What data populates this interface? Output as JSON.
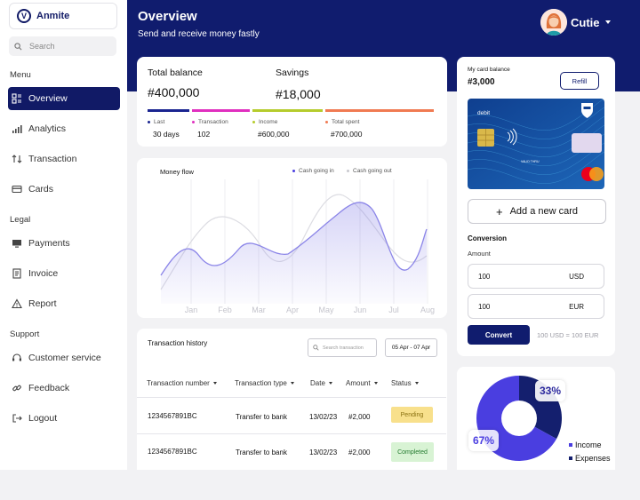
{
  "app": {
    "name": "Anmite",
    "logo_letter": "V"
  },
  "search": {
    "placeholder": "Search"
  },
  "sidebar": {
    "sections": {
      "menu": "Menu",
      "legal": "Legal",
      "support": "Support"
    },
    "items": [
      {
        "label": "Overview",
        "icon": "grid-icon",
        "active": true
      },
      {
        "label": "Analytics",
        "icon": "bar-chart-icon"
      },
      {
        "label": "Transaction",
        "icon": "swap-arrows-icon"
      },
      {
        "label": "Cards",
        "icon": "credit-card-icon"
      },
      {
        "label": "Payments",
        "icon": "monitor-icon"
      },
      {
        "label": "Invoice",
        "icon": "invoice-icon"
      },
      {
        "label": "Report",
        "icon": "warning-triangle-icon"
      },
      {
        "label": "Customer service",
        "icon": "headset-icon"
      },
      {
        "label": "Feedback",
        "icon": "link-icon"
      },
      {
        "label": "Logout",
        "icon": "logout-icon"
      }
    ]
  },
  "header": {
    "title": "Overview",
    "subtitle": "Send and receive money fastly",
    "user": "Cutie"
  },
  "balance": {
    "total_label": "Total balance",
    "total_value": "#400,000",
    "savings_label": "Savings",
    "savings_value": "#18,000",
    "stats": [
      {
        "label": "Last",
        "value": "30 days",
        "color": "#1a2490"
      },
      {
        "label": "Transaction",
        "value": "102",
        "color": "#e02fbf"
      },
      {
        "label": "Income",
        "value": "#600,000",
        "color": "#b5cc2c"
      },
      {
        "label": "Total spent",
        "value": "#700,000",
        "color": "#f07a52"
      }
    ]
  },
  "money_flow": {
    "title": "Money flow",
    "legend_in": "Cash going in",
    "legend_out": "Cash going out",
    "months": [
      "Jan",
      "Feb",
      "Mar",
      "Apr",
      "May",
      "Jun",
      "Jul",
      "Aug"
    ]
  },
  "transactions": {
    "title": "Transaction history",
    "search_placeholder": "Search transaction",
    "date_range": "05 Apr - 07 Apr",
    "columns": [
      "Transaction number",
      "Transaction type",
      "Date",
      "Amount",
      "Status"
    ],
    "rows": [
      {
        "number": "1234567891BC",
        "type": "Transfer to bank",
        "date": "13/02/23",
        "amount": "#2,000",
        "status": "Pending"
      },
      {
        "number": "1234567891BC",
        "type": "Transfer to bank",
        "date": "13/02/23",
        "amount": "#2,000",
        "status": "Completed"
      }
    ]
  },
  "card_panel": {
    "label": "My card balance",
    "balance": "#3,000",
    "refill": "Refill",
    "card_text": "debit",
    "card_small_text": "VALID THRU",
    "add_card": "Add a new card",
    "conversion_title": "Conversion",
    "amount_label": "Amount",
    "from_value": "100",
    "from_currency": "USD",
    "to_value": "100",
    "to_currency": "EUR",
    "convert_label": "Convert",
    "result": "100 USD = 100 EUR"
  },
  "donut": {
    "income_pct": "67%",
    "expenses_pct": "33%",
    "legend_income": "Income",
    "legend_expenses": "Expenses",
    "income_value": 67,
    "expenses_value": 33,
    "income_color": "#4a3ee0",
    "expenses_color": "#141f6e"
  }
}
